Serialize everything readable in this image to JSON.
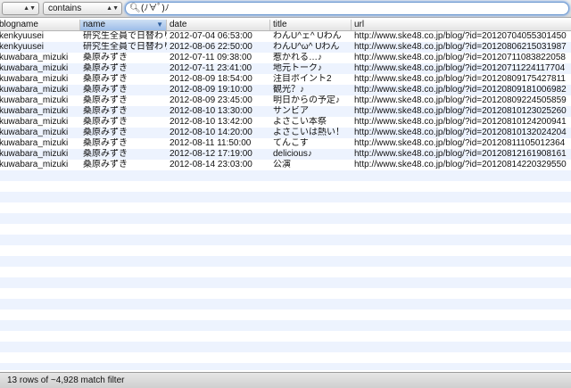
{
  "filter": {
    "column_popup": "",
    "operator_popup": "contains",
    "search_value": "(ﾉ∀ﾟ)ﾉ"
  },
  "columns": [
    "blogname",
    "name",
    "date",
    "title",
    "url"
  ],
  "sorted_column": "name",
  "rows": [
    [
      "kenkyuusei",
      "研究生全員で日替わり",
      "2012-07-04 06:53:00",
      "わんU^ェ^ Uわん",
      "http://www.ske48.co.jp/blog/?id=20120704055301450"
    ],
    [
      "kenkyuusei",
      "研究生全員で日替わり",
      "2012-08-06 22:50:00",
      "わんU^ω^ Uわん",
      "http://www.ske48.co.jp/blog/?id=20120806215031987"
    ],
    [
      "kuwabara_mizuki",
      "桑原みずき",
      "2012-07-11 09:38:00",
      "惹かれる…♪",
      "http://www.ske48.co.jp/blog/?id=20120711083822058"
    ],
    [
      "kuwabara_mizuki",
      "桑原みずき",
      "2012-07-11 23:41:00",
      "地元トーク♪",
      "http://www.ske48.co.jp/blog/?id=20120711224117704"
    ],
    [
      "kuwabara_mizuki",
      "桑原みずき",
      "2012-08-09 18:54:00",
      "注目ポイント2",
      "http://www.ske48.co.jp/blog/?id=20120809175427811"
    ],
    [
      "kuwabara_mizuki",
      "桑原みずき",
      "2012-08-09 19:10:00",
      "観光？♪",
      "http://www.ske48.co.jp/blog/?id=20120809181006982"
    ],
    [
      "kuwabara_mizuki",
      "桑原みずき",
      "2012-08-09 23:45:00",
      "明日からの予定♪",
      "http://www.ske48.co.jp/blog/?id=20120809224505859"
    ],
    [
      "kuwabara_mizuki",
      "桑原みずき",
      "2012-08-10 13:30:00",
      "サンビア",
      "http://www.ske48.co.jp/blog/?id=20120810123025260"
    ],
    [
      "kuwabara_mizuki",
      "桑原みずき",
      "2012-08-10 13:42:00",
      "よさこい本祭",
      "http://www.ske48.co.jp/blog/?id=20120810124200941"
    ],
    [
      "kuwabara_mizuki",
      "桑原みずき",
      "2012-08-10 14:20:00",
      "よさこいは熱い！",
      "http://www.ske48.co.jp/blog/?id=20120810132024204"
    ],
    [
      "kuwabara_mizuki",
      "桑原みずき",
      "2012-08-11 11:50:00",
      "てんこす",
      "http://www.ske48.co.jp/blog/?id=20120811105012364"
    ],
    [
      "kuwabara_mizuki",
      "桑原みずき",
      "2012-08-12 17:19:00",
      "delicious♪",
      "http://www.ske48.co.jp/blog/?id=20120812161908161"
    ],
    [
      "kuwabara_mizuki",
      "桑原みずき",
      "2012-08-14 23:03:00",
      "公演",
      "http://www.ske48.co.jp/blog/?id=20120814220329550"
    ]
  ],
  "status": "13 rows of ~4,928 match filter",
  "colors": {
    "alt_row": "#edf3fe",
    "sorted_header": "#9dbde8",
    "search_focus": "#6f9ad1"
  },
  "icons": {
    "search": "magnifier-icon",
    "sort": "sort-descending-icon",
    "popup": "updown-arrows-icon"
  }
}
